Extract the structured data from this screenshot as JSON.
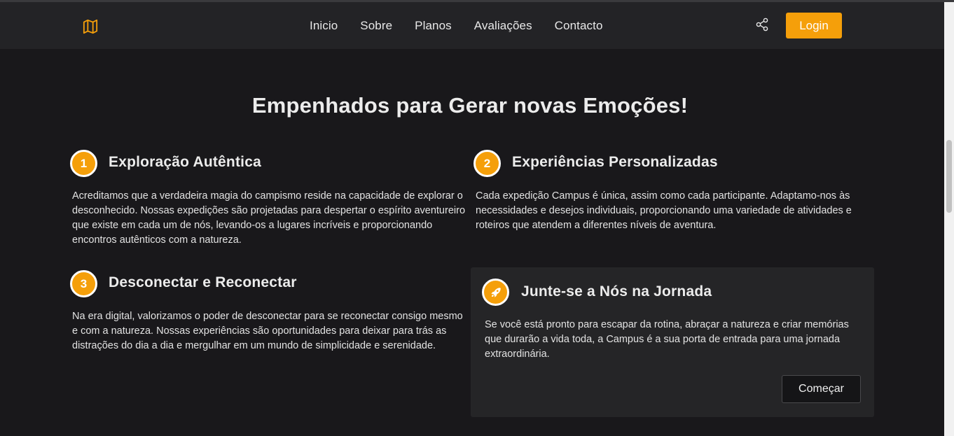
{
  "header": {
    "logo_icon": "map-icon",
    "nav": [
      "Inicio",
      "Sobre",
      "Planos",
      "Avaliações",
      "Contacto"
    ],
    "share_icon": "share-icon",
    "login_label": "Login",
    "accent": "#f59f0a"
  },
  "main": {
    "title": "Empenhados para Gerar novas Emoções!",
    "features": [
      {
        "number": "1",
        "title": "Exploração Autêntica",
        "text": "Acreditamos que a verdadeira magia do campismo reside na capacidade de explorar o desconhecido. Nossas expedições são projetadas para despertar o espírito aventureiro que existe em cada um de nós, levando-os a lugares incríveis e proporcionando encontros autênticos com a natureza."
      },
      {
        "number": "2",
        "title": "Experiências Personalizadas",
        "text": "Cada expedição Campus é única, assim como cada participante. Adaptamo-nos às necessidades e desejos individuais, proporcionando uma variedade de atividades e roteiros que atendem a diferentes níveis de aventura."
      },
      {
        "number": "3",
        "title": "Desconectar e Reconectar",
        "text": "Na era digital, valorizamos o poder de desconectar para se reconectar consigo mesmo e com a natureza. Nossas experiências são oportunidades para deixar para trás as distrações do dia a dia e mergulhar em um mundo de simplicidade e serenidade."
      }
    ],
    "card": {
      "icon": "rocket-icon",
      "title": "Junte-se a Nós na Jornada",
      "text": "Se você está pronto para escapar da rotina, abraçar a natureza e criar memórias que durarão a vida toda, a Campus é a sua porta de entrada para uma jornada extraordinária.",
      "button_label": "Começar"
    }
  }
}
